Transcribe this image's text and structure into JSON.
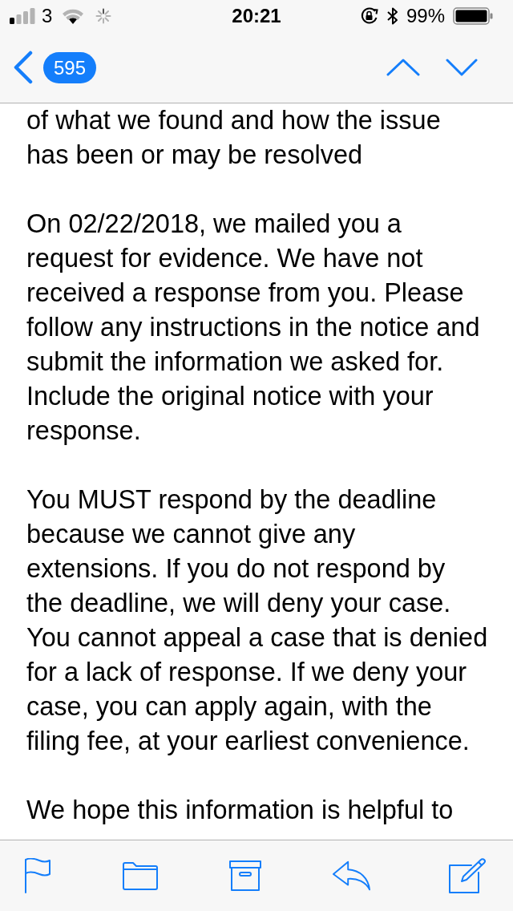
{
  "status_bar": {
    "carrier": "3",
    "time": "20:21",
    "battery": "99%"
  },
  "nav_bar": {
    "unread_count": "595"
  },
  "message": {
    "paragraphs": [
      {
        "lines": [
          "of what we found and how the issue",
          "has been or may be resolved"
        ]
      },
      {
        "lines": [
          "On 02/22/2018, we mailed you a",
          "request for evidence. We have not",
          "received a response from you. Please",
          "follow any instructions in the notice and",
          "submit the information we asked for.",
          "Include the original notice with your",
          "response."
        ]
      },
      {
        "lines": [
          "You MUST respond by the deadline",
          "because we cannot give any",
          "extensions. If you do not respond by",
          "the deadline, we will deny your case.",
          "You cannot appeal a case that is denied",
          "for a lack of response. If we deny your",
          "case, you can apply again, with the",
          "filing fee, at your earliest convenience."
        ]
      },
      {
        "lines": [
          "We hope this information is helpful to"
        ]
      }
    ]
  }
}
